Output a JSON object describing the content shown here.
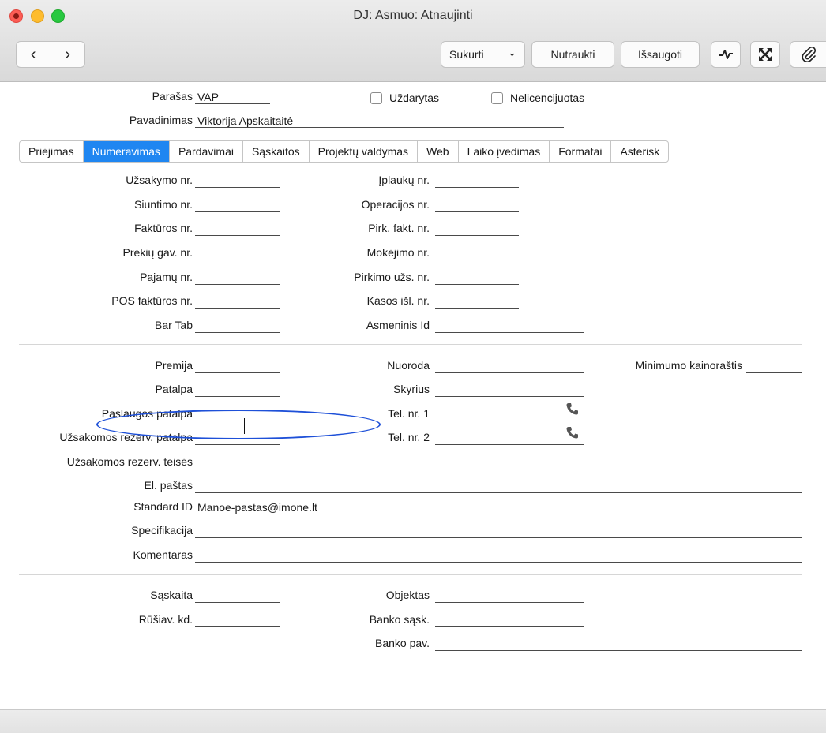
{
  "window": {
    "title": "DJ: Asmuo: Atnaujinti"
  },
  "toolbar": {
    "back_glyph": "‹",
    "forward_glyph": "›",
    "create_label": "Sukurti",
    "create_dropdown_glyph": "⌄",
    "cancel_label": "Nutraukti",
    "save_label": "Išsaugoti",
    "icons": [
      "activity-icon",
      "expand-icon",
      "paperclip-icon"
    ]
  },
  "header": {
    "signature_label": "Parašas",
    "signature_value": "VAP",
    "closed_label": "Uždarytas",
    "unlicensed_label": "Nelicencijuotas",
    "name_label": "Pavadinimas",
    "name_value": "Viktorija Apskaitaitė"
  },
  "tabs": [
    {
      "label": "Priėjimas"
    },
    {
      "label": "Numeravimas"
    },
    {
      "label": "Pardavimai"
    },
    {
      "label": "Sąskaitos"
    },
    {
      "label": "Projektų valdymas"
    },
    {
      "label": "Web"
    },
    {
      "label": "Laiko įvedimas"
    },
    {
      "label": "Formatai"
    },
    {
      "label": "Asterisk"
    }
  ],
  "active_tab": "Numeravimas",
  "numbering": {
    "left": [
      {
        "label": "Užsakymo nr.",
        "value": ""
      },
      {
        "label": "Siuntimo nr.",
        "value": ""
      },
      {
        "label": "Faktūros nr.",
        "value": ""
      },
      {
        "label": "Prekių gav. nr.",
        "value": ""
      },
      {
        "label": "Pajamų nr.",
        "value": ""
      },
      {
        "label": "POS faktūros nr.",
        "value": ""
      },
      {
        "label": "Bar Tab",
        "value": ""
      }
    ],
    "right": [
      {
        "label": "Įplaukų nr.",
        "value": ""
      },
      {
        "label": "Operacijos nr.",
        "value": ""
      },
      {
        "label": "Pirk. fakt. nr.",
        "value": ""
      },
      {
        "label": "Mokėjimo nr.",
        "value": ""
      },
      {
        "label": "Pirkimo užs. nr.",
        "value": ""
      },
      {
        "label": "Kasos išl. nr.",
        "value": ""
      },
      {
        "label": "Asmeninis Id",
        "value": ""
      }
    ]
  },
  "section2": {
    "premija": {
      "label": "Premija",
      "value": ""
    },
    "nuoroda": {
      "label": "Nuoroda",
      "value": ""
    },
    "min_price": {
      "label": "Minimumo kainoraštis",
      "value": ""
    },
    "patalpa": {
      "label": "Patalpa",
      "value": ""
    },
    "skyrius": {
      "label": "Skyrius",
      "value": ""
    },
    "service_room": {
      "label": "Paslaugos patalpa",
      "value": ""
    },
    "tel1": {
      "label": "Tel. nr. 1",
      "value": ""
    },
    "booked_room": {
      "label": "Užsakomos rezerv. patalpa",
      "value": ""
    },
    "tel2": {
      "label": "Tel. nr. 2",
      "value": ""
    },
    "booking_rights": {
      "label": "Užsakomos rezerv. teisės",
      "value": ""
    },
    "email": {
      "label": "El. paštas",
      "value": ""
    },
    "standard_id": {
      "label": "Standard ID",
      "value": "Manoe-pastas@imone.lt"
    },
    "spec": {
      "label": "Specifikacija",
      "value": ""
    },
    "comment": {
      "label": "Komentaras",
      "value": ""
    }
  },
  "section3": {
    "account": {
      "label": "Sąskaita",
      "value": ""
    },
    "object": {
      "label": "Objektas",
      "value": ""
    },
    "sort_code": {
      "label": "Rūšiav. kd.",
      "value": ""
    },
    "bank_account": {
      "label": "Banko sąsk.",
      "value": ""
    },
    "bank_name": {
      "label": "Banko pav.",
      "value": ""
    }
  },
  "colors": {
    "tab_active": "#1f86f1",
    "highlight_ellipse": "#1e50d8",
    "close": "#fd5d55",
    "minimize": "#febc2e",
    "maximize": "#28c840"
  }
}
